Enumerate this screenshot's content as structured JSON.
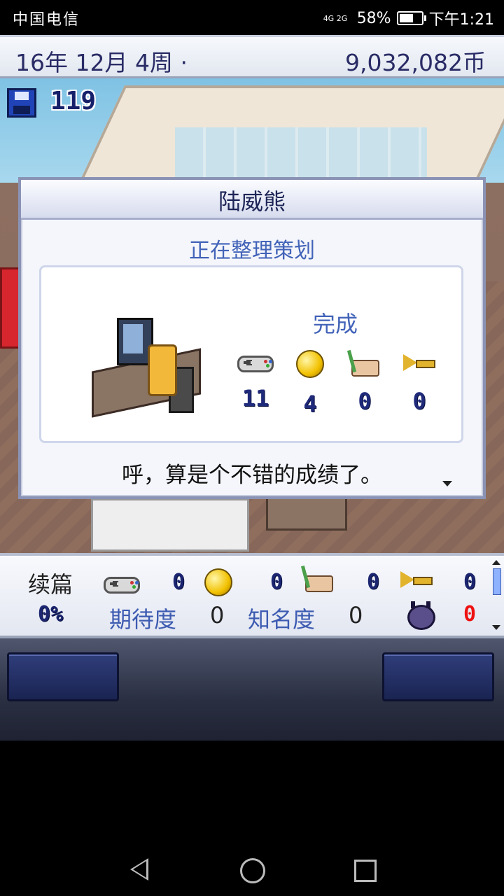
{
  "status_bar": {
    "carrier": "中国电信",
    "network": "4G 2G",
    "battery": "58%",
    "time": "下午1:21"
  },
  "top_bar": {
    "date": "16年 12月 4周 ·",
    "money": "9,032,082币"
  },
  "saves": {
    "count": "119",
    "icon": "floppy-disk-icon"
  },
  "dialog": {
    "name": "陆威熊",
    "activity": "正在整理策划",
    "status": "完成",
    "stats": [
      {
        "icon": "gamepad-icon",
        "value": "11"
      },
      {
        "icon": "coin-icon",
        "value": "4"
      },
      {
        "icon": "paint-palette-icon",
        "value": "0"
      },
      {
        "icon": "trumpet-icon",
        "value": "0"
      }
    ],
    "message": "呼，算是个不错的成绩了。"
  },
  "info_panel": {
    "sequel_label": "续篇",
    "progress": "0%",
    "stat_values": {
      "fun": "0",
      "creativity": "0",
      "graphics": "0",
      "sound": "0"
    },
    "expectation_label": "期待度",
    "expectation_value": "0",
    "fame_label": "知名度",
    "fame_value": "0",
    "bugs_value": "0"
  },
  "colors": {
    "accent": "#4263b8",
    "dark_text": "#1d2557",
    "bug_red": "#ee1111"
  }
}
